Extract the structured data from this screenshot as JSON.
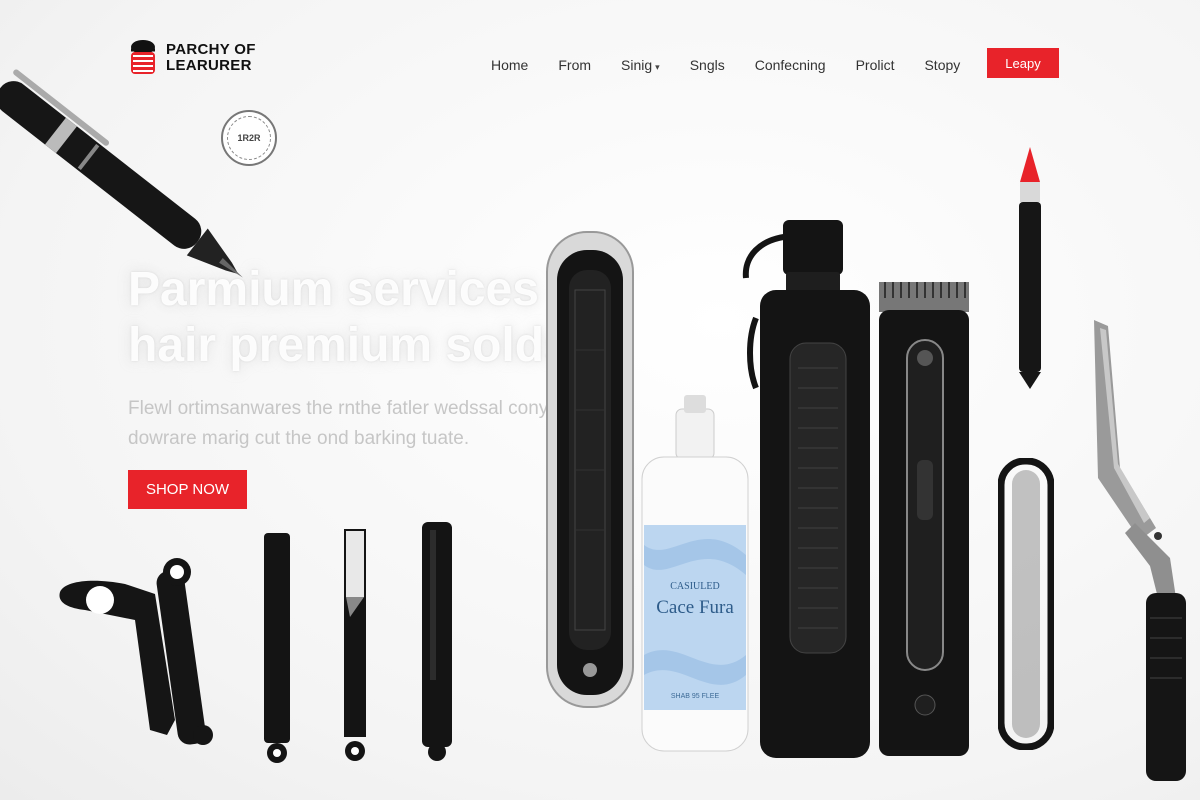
{
  "brand": {
    "line1": "PARCHY OF",
    "line2": "LEARURER"
  },
  "nav": {
    "items": [
      {
        "label": "Home"
      },
      {
        "label": "From"
      },
      {
        "label": "Sinig",
        "has_dropdown": true
      },
      {
        "label": "Sngls"
      },
      {
        "label": "Confecning"
      },
      {
        "label": "Prolict"
      },
      {
        "label": "Stopy"
      }
    ],
    "cta_label": "Leapy"
  },
  "badge": {
    "text": "1R2R"
  },
  "hero": {
    "title_line1": "Parmium services",
    "title_line2": "hair premium solds",
    "subtitle_line1": "Flewl ortimsanwares the rnthe fatler wedssal conyerd",
    "subtitle_line2": "dowrare marig cut the ond barking tuate.",
    "cta_label": "SHOP NOW"
  },
  "product_bottle": {
    "brand": "CASIULED",
    "name": "Cace Fura",
    "bottom_text": "SHAB 95 FLEE"
  },
  "colors": {
    "accent": "#e8232a",
    "dark": "#111111",
    "bottle_blue": "#bcd6f0"
  },
  "icons": [
    "logo-mark-icon",
    "caret-down-icon"
  ]
}
